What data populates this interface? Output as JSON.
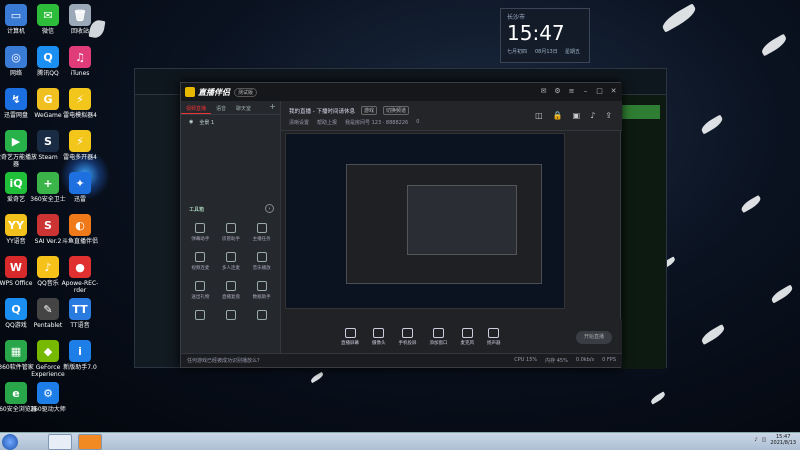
{
  "desktop_icons": [
    {
      "label": "计算机",
      "color": "#3a7bd5",
      "glyph": "▭"
    },
    {
      "label": "微信",
      "color": "#2dbd3a",
      "glyph": "✉"
    },
    {
      "label": "回收站",
      "color": "#9aa8b8",
      "glyph": "🗑"
    },
    {
      "label": "网络",
      "color": "#3a7bd5",
      "glyph": "◎"
    },
    {
      "label": "腾讯QQ",
      "color": "#1b8ef2",
      "glyph": "Q"
    },
    {
      "label": "iTunes",
      "color": "#e03c7a",
      "glyph": "♫"
    },
    {
      "label": "迅雷网盘",
      "color": "#1b6fe0",
      "glyph": "↯"
    },
    {
      "label": "WeGame",
      "color": "#f0c020",
      "glyph": "G"
    },
    {
      "label": "雷电模拟器4",
      "color": "#f2c61a",
      "glyph": "⚡"
    },
    {
      "label": "爱奇艺万能播放器",
      "color": "#27b34a",
      "glyph": "▶"
    },
    {
      "label": "Steam",
      "color": "#1a2c44",
      "glyph": "S"
    },
    {
      "label": "雷电多开器4",
      "color": "#f2c61a",
      "glyph": "⚡"
    },
    {
      "label": "爱奇艺",
      "color": "#1fbf3a",
      "glyph": "iQ"
    },
    {
      "label": "360安全卫士",
      "color": "#3bb54a",
      "glyph": "+"
    },
    {
      "label": "迅雷",
      "color": "#1e6fe0",
      "glyph": "✦"
    },
    {
      "label": "YY语音",
      "color": "#f3c11b",
      "glyph": "YY"
    },
    {
      "label": "SAI Ver.2",
      "color": "#cc3333",
      "glyph": "S"
    },
    {
      "label": "斗鱼直播伴侣",
      "color": "#f07a1a",
      "glyph": "◐"
    },
    {
      "label": "WPS Office",
      "color": "#d82a2a",
      "glyph": "W"
    },
    {
      "label": "QQ音乐",
      "color": "#f6c21a",
      "glyph": "♪"
    },
    {
      "label": "Apowe-REC-rder",
      "color": "#e03030",
      "glyph": "●"
    },
    {
      "label": "QQ游戏",
      "color": "#1b8ef2",
      "glyph": "Q"
    },
    {
      "label": "Pentablet",
      "color": "#444",
      "glyph": "✎"
    },
    {
      "label": "TT语音",
      "color": "#2a7be0",
      "glyph": "TT"
    },
    {
      "label": "360软件管家",
      "color": "#2aa64a",
      "glyph": "▦"
    },
    {
      "label": "GeForce Experience",
      "color": "#76b900",
      "glyph": "◆"
    },
    {
      "label": "新版助手7.0",
      "color": "#1e7ee8",
      "glyph": "i"
    },
    {
      "label": "360安全浏览器",
      "color": "#2aa64a",
      "glyph": "e"
    },
    {
      "label": "360驱动大师",
      "color": "#1e7ee8",
      "glyph": "⚙"
    }
  ],
  "widget": {
    "city": "长沙市",
    "time": "15:47",
    "date_line": "七月初四",
    "date2": "08月13日",
    "weekday": "星期五"
  },
  "app": {
    "name": "直播伴侣",
    "version": "测试版",
    "tabs": [
      "视频直播",
      "语音",
      "聊天室"
    ],
    "scene": "全景 1",
    "toolbox_title": "工具箱",
    "tools": [
      "弹幕助手",
      "房管助手",
      "主播任务",
      "视频连麦",
      "多人连麦",
      "音乐播放",
      "送出礼物",
      "直播复盘",
      "数据助手",
      "",
      "",
      ""
    ],
    "info": {
      "title": "我的直播 - 下播时间请休息",
      "tag1": "游戏",
      "tag2": "切换频道",
      "status1": "清晰设置",
      "status2": "帮助上报",
      "room": "我是房间号 123 · 8888226",
      "fans": "0"
    },
    "controls": [
      "直播屏幕",
      "摄像头",
      "手机投屏",
      "添加窗口",
      "麦克风",
      "扬声器"
    ],
    "start_button": "开始直播",
    "bottom_left": "任何游戏已经被成功识别播放么？",
    "bottom_right": [
      "CPU 15%",
      "内存 45%",
      "0.0kb/s",
      "0 FPS"
    ]
  },
  "taskbar": {
    "clock_time": "15:47",
    "clock_date": "2021/8/13"
  }
}
